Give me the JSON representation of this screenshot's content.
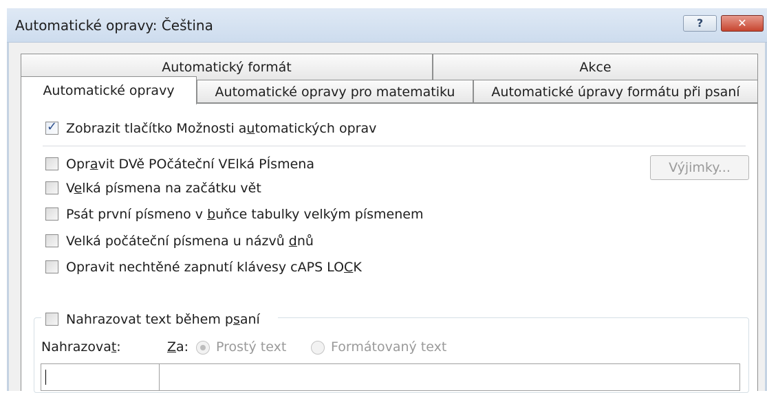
{
  "window": {
    "title": "Automatické opravy: Čeština",
    "help_icon": "?",
    "close_icon": "✕"
  },
  "tabs": {
    "row1": [
      {
        "label": "Automatický formát"
      },
      {
        "label": "Akce"
      }
    ],
    "row2": [
      {
        "label": "Automatické opravy",
        "selected": true
      },
      {
        "label": "Automatické opravy pro matematiku"
      },
      {
        "label": "Automatické úpravy formátu při psaní"
      }
    ]
  },
  "options": {
    "show_buttons": {
      "pre": "Zobrazit tlačítko Možnosti a",
      "key": "u",
      "post": "tomatických oprav",
      "checked": true
    },
    "two_initials": {
      "pre": "Opr",
      "key": "a",
      "post": "vit DVě POčáteční VElká PÍsmena",
      "checked": false
    },
    "sentence_caps": {
      "pre": "V",
      "key": "e",
      "post": "lká písmena na začátku vět",
      "checked": false
    },
    "table_caps": {
      "pre": "Psát první písmeno v ",
      "key": "b",
      "post": "uňce tabulky velkým písmenem",
      "checked": false
    },
    "day_names": {
      "pre": "Velká počáteční písmena u názvů ",
      "key": "d",
      "post": "nů",
      "checked": false
    },
    "caps_lock": {
      "pre": "Opravit nechtěné zapnutí klávesy cAPS LO",
      "key": "C",
      "post": "K",
      "checked": false
    }
  },
  "exceptions_button": "Výjimky...",
  "replace": {
    "group_label": {
      "pre": "Nahrazovat text během p",
      "key": "s",
      "post": "aní",
      "checked": false
    },
    "replace_label": {
      "pre": "Nahrazova",
      "key": "t",
      "post": ":"
    },
    "with_label": {
      "key": "Z",
      "post": "a:"
    },
    "plain_text": "Prostý text",
    "formatted_text": "Formátovaný text",
    "plain_selected": true,
    "replace_value": "",
    "with_value": ""
  }
}
